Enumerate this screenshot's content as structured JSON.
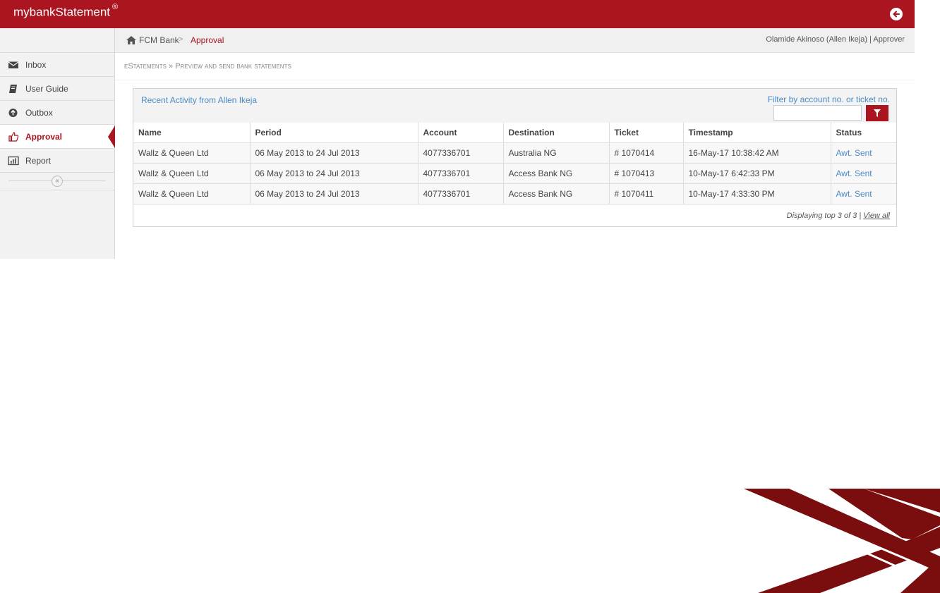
{
  "app": {
    "title": "mybankStatement",
    "registered_mark": "®",
    "accent_color": "#ab1520",
    "back_icon": "arrow-left-circle-icon"
  },
  "sidebar": {
    "items": [
      {
        "label": "Inbox",
        "icon": "envelope-icon",
        "active": false
      },
      {
        "label": "User Guide",
        "icon": "book-icon",
        "active": false
      },
      {
        "label": "Outbox",
        "icon": "arrow-up-circle-icon",
        "active": false
      },
      {
        "label": "Approval",
        "icon": "thumbs-up-icon",
        "active": true
      },
      {
        "label": "Report",
        "icon": "bar-chart-icon",
        "active": false
      }
    ],
    "collapse_icon": "double-chevron-left-icon"
  },
  "breadcrumb": {
    "root": "FCM Bank",
    "separator": ">",
    "current": "Approval"
  },
  "user": {
    "info": "Olamide Akinoso (Allen Ikeja) | Approver"
  },
  "section": {
    "title": "eStatements",
    "separator": "»",
    "subtitle": "Preview and send bank statements"
  },
  "activity": {
    "title": "Recent Activity from Allen Ikeja",
    "filter_label": "Filter by account no. or ticket no.",
    "filter_value": "",
    "columns": [
      "Name",
      "Period",
      "Account",
      "Destination",
      "Ticket",
      "Timestamp",
      "Status"
    ],
    "rows": [
      {
        "name": "Wallz & Queen Ltd",
        "period": "06 May 2013 to 24 Jul 2013",
        "account": "4077336701",
        "destination": "Australia NG",
        "ticket": "# 1070414",
        "timestamp": "16-May-17 10:38:42 AM",
        "status": "Awt. Sent"
      },
      {
        "name": "Wallz & Queen Ltd",
        "period": "06 May 2013 to 24 Jul 2013",
        "account": "4077336701",
        "destination": "Access Bank NG",
        "ticket": "# 1070413",
        "timestamp": "10-May-17 6:42:33 PM",
        "status": "Awt. Sent"
      },
      {
        "name": "Wallz & Queen Ltd",
        "period": "06 May 2013 to 24 Jul 2013",
        "account": "4077336701",
        "destination": "Access Bank NG",
        "ticket": "# 1070411",
        "timestamp": "10-May-17 4:33:30 PM",
        "status": "Awt. Sent"
      }
    ],
    "footer_text": "Displaying top 3 of 3",
    "footer_separator": "|",
    "view_all": "View all"
  }
}
